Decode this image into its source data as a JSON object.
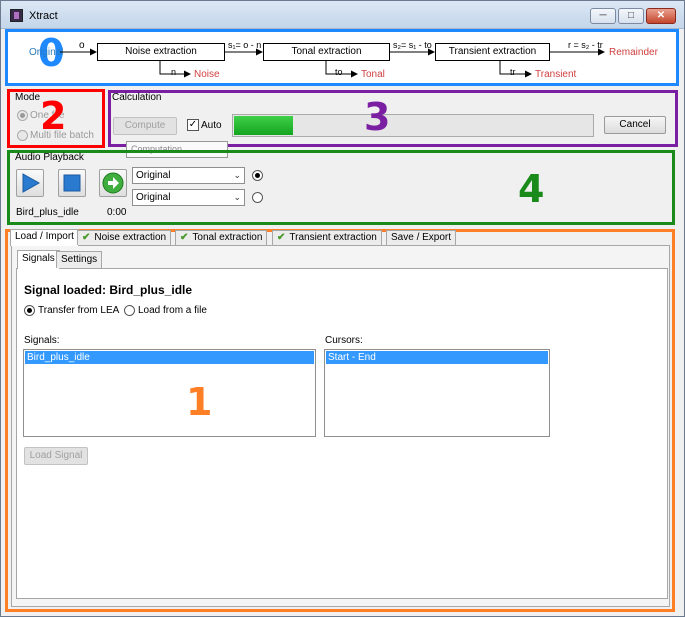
{
  "window": {
    "title": "Xtract",
    "controls": {
      "minimize": "─",
      "maximize": "□",
      "close": "✕"
    }
  },
  "annotations": {
    "box0": "0",
    "box1": "1",
    "box2": "2",
    "box3": "3",
    "box4": "4"
  },
  "pipeline": {
    "input_label": "Original",
    "o_label": "o",
    "stages": [
      {
        "name": "Noise extraction",
        "out_symbol": "n",
        "out_label": "Noise",
        "next_formula": "s₁= o - n"
      },
      {
        "name": "Tonal  extraction",
        "out_symbol": "to",
        "out_label": "Tonal",
        "next_formula": "s₂= s₁ - to"
      },
      {
        "name": "Transient  extraction",
        "out_symbol": "tr",
        "out_label": "Transient",
        "next_formula": "r = s₂ - tr"
      }
    ],
    "remainder_label": "Remainder"
  },
  "mode": {
    "title": "Mode",
    "options": [
      {
        "label": "One file",
        "selected": true,
        "enabled": false
      },
      {
        "label": "Multi file batch",
        "selected": false,
        "enabled": false
      }
    ]
  },
  "calculation": {
    "title": "Calculation",
    "compute_label": "Compute",
    "auto_label": "Auto",
    "auto_checked": true,
    "progress_fraction": 0.165,
    "cancel_label": "Cancel",
    "popup_text": "Computation ..."
  },
  "playback": {
    "title": "Audio Playback",
    "signal_name": "Bird_plus_idle",
    "time": "0:00",
    "selects": [
      {
        "value": "Original",
        "selected": true
      },
      {
        "value": "Original",
        "selected": false
      }
    ]
  },
  "tabs": [
    {
      "label": "Load / Import",
      "checked": false,
      "active": true
    },
    {
      "label": "Noise extraction",
      "checked": true,
      "active": false
    },
    {
      "label": "Tonal extraction",
      "checked": true,
      "active": false
    },
    {
      "label": "Transient extraction",
      "checked": true,
      "active": false
    },
    {
      "label": "Save / Export",
      "checked": false,
      "active": false
    }
  ],
  "subtabs": [
    {
      "label": "Signals",
      "active": true
    },
    {
      "label": "Settings",
      "active": false
    }
  ],
  "load": {
    "heading": "Signal loaded: Bird_plus_idle",
    "source_options": [
      {
        "label": "Transfer from LEA",
        "selected": true
      },
      {
        "label": "Load from a file",
        "selected": false
      }
    ],
    "signals_label": "Signals:",
    "signals": [
      "Bird_plus_idle"
    ],
    "cursors_label": "Cursors:",
    "cursors": [
      "Start - End"
    ],
    "load_button": "Load Signal"
  },
  "colors": {
    "box0": "#1e88ff",
    "box1": "#ff7f27",
    "box2": "#ff0000",
    "box3": "#7b1fa2",
    "box4": "#1a8a1a",
    "progress": "#14a41f",
    "selection": "#3399ff",
    "output_label": "#d04040",
    "input_label": "#2a7ab8"
  }
}
